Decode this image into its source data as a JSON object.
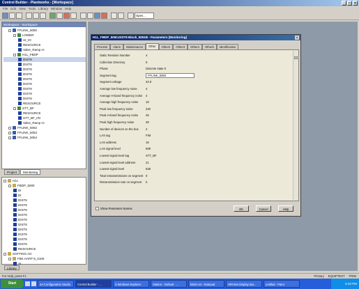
{
  "app": {
    "title": "Control Builder - Plantworks - [Workspace]",
    "menu": [
      "File",
      "Edit",
      "View",
      "Tools",
      "Library",
      "Window",
      "Help"
    ],
    "toolbar_combo": "Open..."
  },
  "project_panel": {
    "header": "Workspace - Workspace",
    "items": [
      {
        "indent": 1,
        "label": "FFLINK_5050",
        "icon": "pc",
        "expander": "-"
      },
      {
        "indent": 2,
        "label": "LOWER",
        "icon": "gr",
        "expander": "-"
      },
      {
        "indent": 3,
        "label": "UI_IO",
        "icon": "bl"
      },
      {
        "indent": 3,
        "label": "RESOURCE",
        "icon": "bl"
      },
      {
        "indent": 3,
        "label": "Valve_Ramp AI",
        "icon": "bl"
      },
      {
        "indent": 2,
        "label": "H1L_FBDP",
        "icon": "gr",
        "expander": "-"
      },
      {
        "indent": 3,
        "label": "DIST8",
        "icon": "bl",
        "selected": true
      },
      {
        "indent": 3,
        "label": "DIST8",
        "icon": "bl"
      },
      {
        "indent": 3,
        "label": "DIST8",
        "icon": "bl"
      },
      {
        "indent": 3,
        "label": "DIST8",
        "icon": "bl"
      },
      {
        "indent": 3,
        "label": "DIST8",
        "icon": "bl"
      },
      {
        "indent": 3,
        "label": "DIST8",
        "icon": "bl"
      },
      {
        "indent": 3,
        "label": "DIST8",
        "icon": "bl"
      },
      {
        "indent": 3,
        "label": "DIST8",
        "icon": "bl"
      },
      {
        "indent": 3,
        "label": "DIST8",
        "icon": "bl"
      },
      {
        "indent": 3,
        "label": "RESOURCE",
        "icon": "bl"
      },
      {
        "indent": 2,
        "label": "STT_BF",
        "icon": "gr",
        "expander": "-"
      },
      {
        "indent": 3,
        "label": "RESOURCE",
        "icon": "bl"
      },
      {
        "indent": 3,
        "label": "STT_BF_I/O",
        "icon": "bl"
      },
      {
        "indent": 3,
        "label": "Valve_Ramp AI",
        "icon": "bl"
      },
      {
        "indent": 1,
        "label": "FFLINK_5052",
        "icon": "pc",
        "expander": "+"
      },
      {
        "indent": 1,
        "label": "FFLINK_5053",
        "icon": "pc",
        "expander": "+"
      },
      {
        "indent": 1,
        "label": "FFLINK_5054",
        "icon": "pc",
        "expander": "+"
      }
    ],
    "tabs": [
      "Project",
      "Monitoring"
    ]
  },
  "library_panel": {
    "items": [
      {
        "indent": 0,
        "label": "H1L",
        "icon": "fd",
        "expander": "-"
      },
      {
        "indent": 1,
        "label": "FBDP_5000",
        "icon": "fd",
        "expander": "-"
      },
      {
        "indent": 2,
        "label": "DI",
        "icon": "bl"
      },
      {
        "indent": 2,
        "label": "DI",
        "icon": "bl"
      },
      {
        "indent": 2,
        "label": "DIST8",
        "icon": "bl"
      },
      {
        "indent": 2,
        "label": "DIST8",
        "icon": "bl"
      },
      {
        "indent": 2,
        "label": "DIST8",
        "icon": "bl"
      },
      {
        "indent": 2,
        "label": "DIST8",
        "icon": "bl"
      },
      {
        "indent": 2,
        "label": "DIST8",
        "icon": "bl"
      },
      {
        "indent": 2,
        "label": "DIST8",
        "icon": "bl"
      },
      {
        "indent": 2,
        "label": "DIST8",
        "icon": "bl"
      },
      {
        "indent": 2,
        "label": "DIST8",
        "icon": "bl"
      },
      {
        "indent": 2,
        "label": "DIST8",
        "icon": "bl"
      },
      {
        "indent": 2,
        "label": "DIST8",
        "icon": "bl"
      },
      {
        "indent": 2,
        "label": "RESOURCE",
        "icon": "bl"
      },
      {
        "indent": 0,
        "label": "SOFTING AG",
        "icon": "fd",
        "expander": "-"
      },
      {
        "indent": 1,
        "label": "FBK HART-5_0100",
        "icon": "fd",
        "expander": "-"
      },
      {
        "indent": 2,
        "label": "AI",
        "icon": "bl"
      }
    ],
    "tab": "Library"
  },
  "dialog": {
    "title": "H1L_FBDP_5050.DIST8 Block_5051B - Parameters [Monitoring]",
    "tabs": [
      "Process",
      "Alarm",
      "Maintenance",
      "Other",
      "Other2",
      "Other3",
      "Other4",
      "Other5",
      "Identification"
    ],
    "active_tab": "Other",
    "params": [
      {
        "label": "Static Revision Number",
        "value": "4"
      },
      {
        "label": "Collection Directory",
        "value": "0"
      },
      {
        "label": "Phase",
        "value": "Discrete state 0"
      },
      {
        "label": "Segment tag",
        "value": "FFLINK_5050",
        "input": true
      },
      {
        "label": "Segment voltage",
        "value": "22.9"
      },
      {
        "label": "Average low frequency noise",
        "value": "4"
      },
      {
        "label": "Average H-band frequency noise",
        "value": "4"
      },
      {
        "label": "Average high frequency noise",
        "value": "18"
      },
      {
        "label": "Peak low frequency noise",
        "value": "230"
      },
      {
        "label": "Peak H-band frequency noise",
        "value": "46"
      },
      {
        "label": "Peak high frequency noise",
        "value": "39"
      },
      {
        "label": "Number of devices on the bus",
        "value": "4"
      },
      {
        "label": "LAS tag",
        "value": "FIM"
      },
      {
        "label": "LAS address",
        "value": "16"
      },
      {
        "label": "LAS signal level",
        "value": "599"
      },
      {
        "label": "Lowest signal level tag",
        "value": "STT_BF"
      },
      {
        "label": "Lowest signal level address",
        "value": "21"
      },
      {
        "label": "Lowest signal level",
        "value": "638"
      },
      {
        "label": "Total retransmissions on segment",
        "value": "0"
      },
      {
        "label": "Retransmission rate on segment",
        "value": "0"
      }
    ],
    "show_params_label": "Show Parameter Names",
    "ok": "OK",
    "cancel": "Cancel",
    "help": "Help"
  },
  "status": {
    "left": "For Help, press F1",
    "right": [
      "Primary",
      "EQUIPTEST",
      "PRIM"
    ]
  },
  "taskbar": {
    "start": "Start",
    "tasks": [
      {
        "label": "4A Configuration Studio"
      },
      {
        "label": "Control Builder - ..."
      },
      {
        "label": "3 Windows Explorer"
      },
      {
        "label": "Station - Default - ..."
      },
      {
        "label": "fabric.txt - Notepad"
      },
      {
        "label": "HRView Display Bui..."
      },
      {
        "label": "untitled - Paint"
      }
    ],
    "clock": "5:40 PM"
  }
}
